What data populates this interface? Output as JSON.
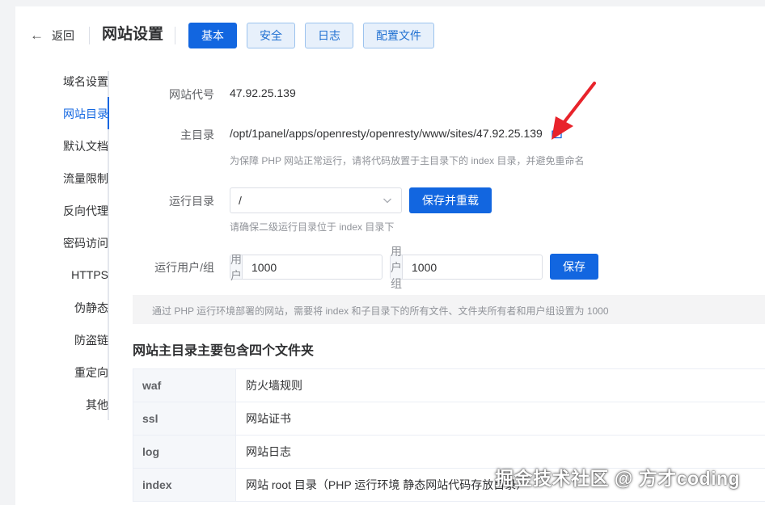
{
  "header": {
    "back_label": "返回",
    "title": "网站设置",
    "tabs": [
      {
        "label": "基本",
        "active": true
      },
      {
        "label": "安全",
        "active": false
      },
      {
        "label": "日志",
        "active": false
      },
      {
        "label": "配置文件",
        "active": false
      }
    ]
  },
  "sidebar": {
    "items": [
      {
        "label": "域名设置"
      },
      {
        "label": "网站目录",
        "active": true
      },
      {
        "label": "默认文档"
      },
      {
        "label": "流量限制"
      },
      {
        "label": "反向代理"
      },
      {
        "label": "密码访问"
      },
      {
        "label": "HTTPS"
      },
      {
        "label": "伪静态"
      },
      {
        "label": "防盗链"
      },
      {
        "label": "重定向"
      },
      {
        "label": "其他"
      }
    ]
  },
  "form": {
    "site_code": {
      "label": "网站代号",
      "value": "47.92.25.139"
    },
    "root_dir": {
      "label": "主目录",
      "value": "/opt/1panel/apps/openresty/openresty/www/sites/47.92.25.139",
      "hint": "为保障 PHP 网站正常运行，请将代码放置于主目录下的 index 目录，并避免重命名"
    },
    "run_dir": {
      "label": "运行目录",
      "selected": "/",
      "button": "保存并重载",
      "hint": "请确保二级运行目录位于 index 目录下"
    },
    "run_user": {
      "label": "运行用户/组",
      "user_prefix": "用户",
      "user_value": "1000",
      "group_prefix": "用户组",
      "group_value": "1000",
      "button": "保存"
    }
  },
  "notice": "通过 PHP 运行环境部署的网站，需要将 index 和子目录下的所有文件、文件夹所有者和用户组设置为 1000",
  "folders_section": {
    "title": "网站主目录主要包含四个文件夹",
    "rows": [
      {
        "name": "waf",
        "desc": "防火墙规则"
      },
      {
        "name": "ssl",
        "desc": "网站证书"
      },
      {
        "name": "log",
        "desc": "网站日志"
      },
      {
        "name": "index",
        "desc": "网站 root 目录（PHP 运行环境 静态网站代码存放目录）"
      }
    ]
  },
  "watermark": "掘金技术社区 @ 方才coding",
  "colors": {
    "primary": "#1266e0",
    "annotation": "#e8232b",
    "background": "#f2f3f5"
  },
  "icons": {
    "back": "arrow-left-icon",
    "folder": "folder-open-icon",
    "chevron": "chevron-down-icon"
  }
}
